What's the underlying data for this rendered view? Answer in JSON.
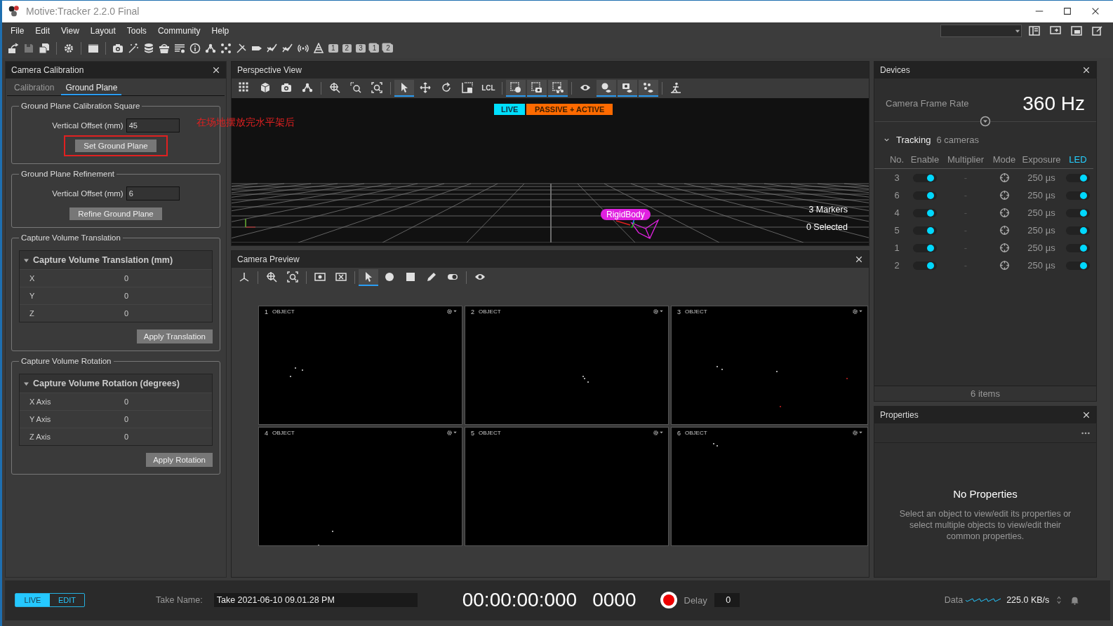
{
  "window": {
    "title": "Motive:Tracker 2.2.0 Final"
  },
  "menu": [
    "File",
    "Edit",
    "View",
    "Layout",
    "Tools",
    "Community",
    "Help"
  ],
  "toolbar": {
    "layout_buttons": [
      "1",
      "2",
      "3",
      "1",
      "2"
    ]
  },
  "calibration": {
    "title": "Camera Calibration",
    "tabs": [
      {
        "label": "Calibration",
        "selected": false
      },
      {
        "label": "Ground Plane",
        "selected": true
      }
    ],
    "ground_square": {
      "title": "Ground Plane Calibration Square",
      "offset_label": "Vertical Offset (mm)",
      "offset_value": "45",
      "button": "Set Ground Plane",
      "highlighted": true
    },
    "annotation": "在场地摆放完水平架后",
    "refinement": {
      "title": "Ground Plane Refinement",
      "offset_label": "Vertical Offset (mm)",
      "offset_value": "6",
      "button": "Refine Ground Plane"
    },
    "translation": {
      "title": "Capture Volume Translation",
      "header": "Capture Volume Translation (mm)",
      "expanded": true,
      "rows": [
        {
          "label": "X",
          "value": "0"
        },
        {
          "label": "Y",
          "value": "0"
        },
        {
          "label": "Z",
          "value": "0"
        }
      ],
      "button": "Apply Translation"
    },
    "rotation": {
      "title": "Capture Volume Rotation",
      "header": "Capture Volume Rotation (degrees)",
      "expanded": true,
      "rows": [
        {
          "label": "X Axis",
          "value": "0"
        },
        {
          "label": "Y Axis",
          "value": "0"
        },
        {
          "label": "Z Axis",
          "value": "0"
        }
      ],
      "button": "Apply Rotation"
    }
  },
  "perspective": {
    "title": "Perspective View",
    "tools": [
      {
        "selected": false
      },
      {
        "selected": false
      },
      {
        "selected": false
      },
      {
        "selected": false
      },
      {
        "selected": false
      },
      {
        "selected": false
      },
      {
        "selected": false
      },
      {
        "selected": true
      },
      {
        "selected": false
      },
      {
        "selected": false
      },
      {
        "selected": false
      },
      {
        "label": "LCL",
        "selected": false
      },
      {
        "selected": true
      },
      {
        "selected": true
      },
      {
        "selected": true
      },
      {
        "selected": false
      },
      {
        "selected": true
      },
      {
        "selected": true
      },
      {
        "selected": true
      },
      {
        "selected": false
      }
    ],
    "live": "LIVE",
    "mode": "PASSIVE + ACTIVE",
    "rigid_body": "RigidBody",
    "markers": "3 Markers",
    "selected_count": "0 Selected"
  },
  "camera_preview": {
    "title": "Camera Preview",
    "tools": [
      {
        "selected": false
      },
      {
        "selected": false
      },
      {
        "selected": false
      },
      {
        "selected": false
      },
      {
        "selected": false
      },
      {
        "selected": true
      },
      {
        "selected": false
      },
      {
        "selected": false
      },
      {
        "selected": false
      },
      {
        "selected": false
      },
      {
        "selected": false
      }
    ],
    "cameras": [
      {
        "number": "1",
        "label": "OBJECT"
      },
      {
        "number": "2",
        "label": "OBJECT"
      },
      {
        "number": "3",
        "label": "OBJECT"
      },
      {
        "number": "4",
        "label": "OBJECT"
      },
      {
        "number": "5",
        "label": "OBJECT"
      },
      {
        "number": "6",
        "label": "OBJECT"
      }
    ]
  },
  "devices": {
    "title": "Devices",
    "frame_rate_label": "Camera Frame Rate",
    "frame_rate": "360 Hz",
    "group": {
      "label": "Tracking",
      "count": "6 cameras",
      "expanded": true
    },
    "columns": [
      {
        "label": "No.",
        "selected": false
      },
      {
        "label": "Enable",
        "selected": false
      },
      {
        "label": "Multiplier",
        "selected": false
      },
      {
        "label": "Mode",
        "selected": false
      },
      {
        "label": "Exposure",
        "selected": false
      },
      {
        "label": "LED",
        "selected": true
      }
    ],
    "rows": [
      {
        "no": "3",
        "enabled": true,
        "multiplier": "-",
        "exposure": "250 µs",
        "led": true
      },
      {
        "no": "6",
        "enabled": true,
        "multiplier": "-",
        "exposure": "250 µs",
        "led": true
      },
      {
        "no": "4",
        "enabled": true,
        "multiplier": "-",
        "exposure": "250 µs",
        "led": true
      },
      {
        "no": "5",
        "enabled": true,
        "multiplier": "-",
        "exposure": "250 µs",
        "led": true
      },
      {
        "no": "1",
        "enabled": true,
        "multiplier": "-",
        "exposure": "250 µs",
        "led": true
      },
      {
        "no": "2",
        "enabled": true,
        "multiplier": "-",
        "exposure": "250 µs",
        "led": true
      }
    ],
    "footer": "6 items"
  },
  "properties": {
    "title": "Properties",
    "empty_title": "No Properties",
    "empty_text": "Select an object to view/edit its properties or select multiple objects to view/edit their common properties."
  },
  "status_bar": {
    "modes": [
      {
        "label": "LIVE",
        "selected": true
      },
      {
        "label": "EDIT",
        "selected": false
      }
    ],
    "take_label": "Take Name:",
    "take_value": "Take 2021-06-10 09.01.28 PM",
    "timecode": "00:00:00:000",
    "frame": "0000",
    "delay_label": "Delay",
    "delay_value": "0",
    "data_label": "Data",
    "data_rate": "225.0 KB/s"
  }
}
